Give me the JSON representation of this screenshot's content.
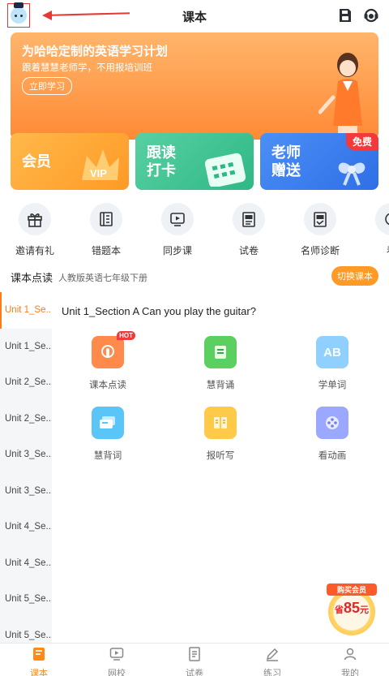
{
  "header": {
    "title": "课本",
    "avatar_icon": "robot-avatar-icon",
    "save_icon": "save-icon",
    "support_icon": "customer-service-icon"
  },
  "banner": {
    "title": "为哈哈定制的英语学习计划",
    "subtitle": "跟着慧慧老师学，不用报培训班",
    "button": "立即学习"
  },
  "cards": {
    "vip": {
      "label": "会员",
      "deco": "VIP"
    },
    "read": {
      "line1": "跟读",
      "line2": "打卡"
    },
    "teacher": {
      "line1": "老师",
      "line2": "赠送",
      "badge": "免费"
    }
  },
  "menu": [
    {
      "label": "邀请有礼",
      "icon": "gift-icon"
    },
    {
      "label": "错题本",
      "icon": "notebook-icon"
    },
    {
      "label": "同步课",
      "icon": "video-icon"
    },
    {
      "label": "试卷",
      "icon": "exam-paper-icon"
    },
    {
      "label": "名师诊断",
      "icon": "diagnosis-icon"
    },
    {
      "label": "看",
      "icon": "watch-icon"
    }
  ],
  "textbook": {
    "title": "课本点读",
    "subtitle": "人教版英语七年级下册",
    "switch_button": "切换课本"
  },
  "units": [
    "Unit 1_Se...",
    "Unit 1_Se...",
    "Unit 2_Se...",
    "Unit 2_Se...",
    "Unit 3_Se...",
    "Unit 3_Se...",
    "Unit 4_Se...",
    "Unit 4_Se...",
    "Unit 5_Se...",
    "Unit 5_Se..."
  ],
  "content": {
    "section_title": "Unit 1_Section A Can you play the guitar?",
    "hot_badge": "HOT",
    "features": [
      {
        "label": "课本点读",
        "icon": "click-read-icon",
        "color": "#ff8a4c"
      },
      {
        "label": "慧背诵",
        "icon": "recite-book-icon",
        "color": "#5bcf5f"
      },
      {
        "label": "学单词",
        "icon": "ab-letters-icon",
        "color": "#8fd0ff",
        "text": "AB"
      },
      {
        "label": "慧背词",
        "icon": "word-cards-icon",
        "color": "#59c6f7"
      },
      {
        "label": "报听写",
        "icon": "dictation-book-icon",
        "color": "#ffc94a"
      },
      {
        "label": "看动画",
        "icon": "film-reel-icon",
        "color": "#9aa8ff"
      }
    ]
  },
  "promo": {
    "tag": "购买会员",
    "save_prefix": "省",
    "save_amount": "85",
    "save_suffix": "元"
  },
  "bottom_nav": [
    {
      "label": "课本",
      "icon": "textbook-icon",
      "active": true
    },
    {
      "label": "网校",
      "icon": "online-school-icon",
      "active": false
    },
    {
      "label": "试卷",
      "icon": "exam-icon",
      "active": false
    },
    {
      "label": "练习",
      "icon": "practice-pen-icon",
      "active": false
    },
    {
      "label": "我的",
      "icon": "profile-icon",
      "active": false
    }
  ],
  "colors": {
    "accent": "#ff8a1a",
    "arrow": "#e53935"
  }
}
